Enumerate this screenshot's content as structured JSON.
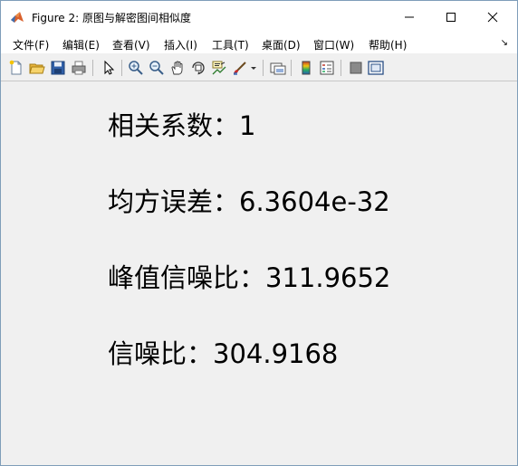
{
  "window": {
    "title": "Figure 2: 原图与解密图间相似度"
  },
  "menu": {
    "items": [
      "文件(F)",
      "编辑(E)",
      "查看(V)",
      "插入(I)",
      "工具(T)",
      "桌面(D)",
      "窗口(W)",
      "帮助(H)"
    ],
    "dock_glyph": "↘"
  },
  "toolbar": {
    "icons": [
      "new-figure-icon",
      "open-icon",
      "save-icon",
      "print-icon",
      "select-pointer-icon",
      "zoom-in-icon",
      "zoom-out-icon",
      "pan-icon",
      "rotate-3d-icon",
      "data-cursor-icon",
      "brush-icon",
      "link-plot-icon",
      "insert-colorbar-icon",
      "insert-legend-icon",
      "hide-plot-tools-icon",
      "show-plot-tools-icon"
    ]
  },
  "metrics": {
    "correlation": "相关系数：1",
    "mse": "均方误差：6.3604e-32",
    "psnr": "峰值信噪比：311.9652",
    "snr": "信噪比：304.9168"
  },
  "colors": {
    "background": "#f0f0f0",
    "titlebar": "#ffffff",
    "text": "#000000"
  }
}
